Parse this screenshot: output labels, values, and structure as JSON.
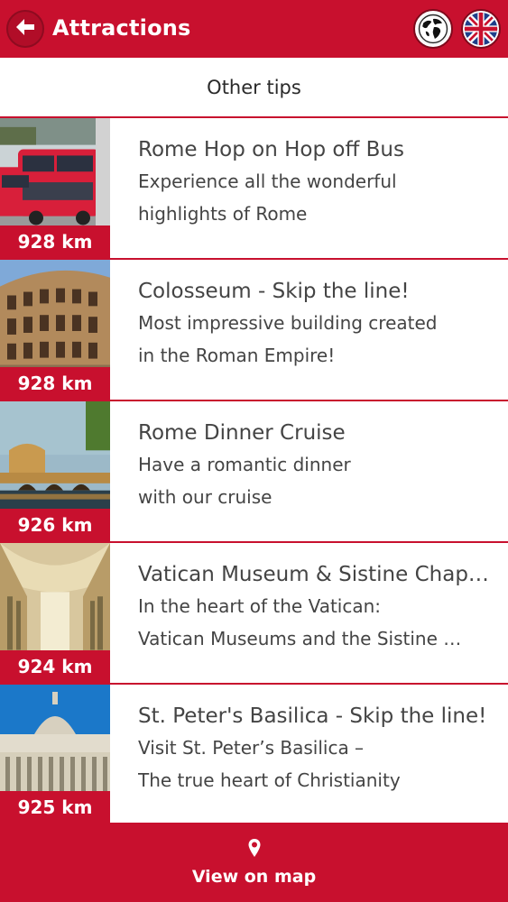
{
  "header": {
    "title": "Attractions",
    "back_icon": "arrow-left-icon",
    "globe_icon": "globe-icon",
    "language_icon": "uk-flag-icon"
  },
  "section": {
    "title": "Other tips"
  },
  "items": [
    {
      "title": "Rome Hop on Hop off Bus",
      "desc1": "Experience all the wonderful",
      "desc2": "highlights of Rome",
      "distance": "928 km",
      "image": "bus-photo"
    },
    {
      "title": "Colosseum - Skip the line!",
      "desc1": "Most impressive building created",
      "desc2": "in the Roman Empire!",
      "distance": "928 km",
      "image": "colosseum-photo"
    },
    {
      "title": "Rome Dinner Cruise",
      "desc1": "Have a romantic dinner",
      "desc2": "with our cruise",
      "distance": "926 km",
      "image": "river-photo"
    },
    {
      "title": "Vatican Museum & Sistine Chap…",
      "desc1": "In the heart of the Vatican:",
      "desc2": "Vatican Museums and the Sistine …",
      "distance": "924 km",
      "image": "museum-photo"
    },
    {
      "title": "St. Peter's Basilica - Skip the line!",
      "desc1": "Visit St. Peter’s Basilica –",
      "desc2": "The true heart of Christianity",
      "distance": "925 km",
      "image": "basilica-photo"
    }
  ],
  "footer": {
    "label": "View on map",
    "icon": "map-pin-icon"
  },
  "colors": {
    "accent": "#c8102e",
    "text": "#444444"
  }
}
